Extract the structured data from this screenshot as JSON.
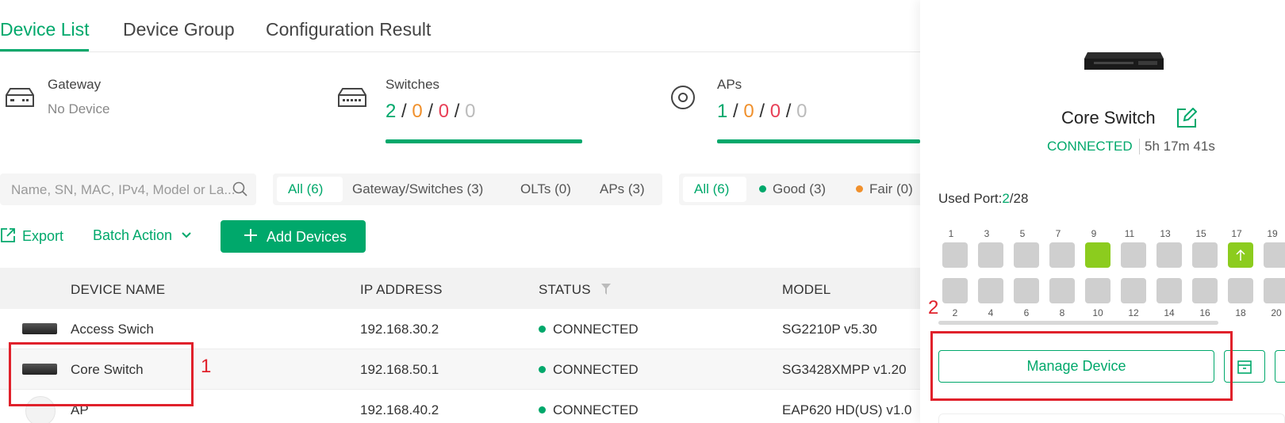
{
  "tabs": [
    {
      "label": "Device List",
      "active": true
    },
    {
      "label": "Device Group"
    },
    {
      "label": "Configuration Result"
    }
  ],
  "summary": {
    "gateway": {
      "title": "Gateway",
      "sub": "No Device"
    },
    "switches": {
      "title": "Switches",
      "counts": [
        "2",
        "0",
        "0",
        "0"
      ]
    },
    "aps": {
      "title": "APs",
      "counts": [
        "1",
        "0",
        "0",
        "0"
      ]
    }
  },
  "search": {
    "placeholder": "Name, SN, MAC, IPv4, Model or La..."
  },
  "type_filter": [
    "All (6)",
    "Gateway/Switches (3)",
    "OLTs (0)",
    "APs (3)"
  ],
  "health_filter": [
    "All (6)",
    "Good (3)",
    "Fair (0)"
  ],
  "actions": {
    "export": "Export",
    "batch": "Batch Action",
    "add": "Add Devices"
  },
  "table": {
    "headers": [
      "DEVICE NAME",
      "IP ADDRESS",
      "STATUS",
      "MODEL"
    ],
    "rows": [
      {
        "name": "Access Swich",
        "ip": "192.168.30.2",
        "status": "CONNECTED",
        "model": "SG2210P v5.30"
      },
      {
        "name": "Core Switch",
        "ip": "192.168.50.1",
        "status": "CONNECTED",
        "model": "SG3428XMPP v1.20"
      },
      {
        "name": "AP",
        "ip": "192.168.40.2",
        "status": "CONNECTED",
        "model": "EAP620 HD(US) v1.0"
      }
    ]
  },
  "annotations": {
    "one": "1",
    "two": "2"
  },
  "panel": {
    "title": "Core Switch",
    "status": "CONNECTED",
    "uptime": "5h 17m 41s",
    "used_port_label": "Used Port:",
    "used_port_used": "2",
    "used_port_total": "/28",
    "top_ports": [
      "1",
      "3",
      "5",
      "7",
      "9",
      "11",
      "13",
      "15",
      "17",
      "19"
    ],
    "bottom_ports": [
      "2",
      "4",
      "6",
      "8",
      "10",
      "12",
      "14",
      "16",
      "18",
      "20"
    ],
    "manage": "Manage Device"
  },
  "colors": {
    "accent": "#00a86b",
    "port_active": "#8ccc1e",
    "annotation": "#e0212b"
  }
}
